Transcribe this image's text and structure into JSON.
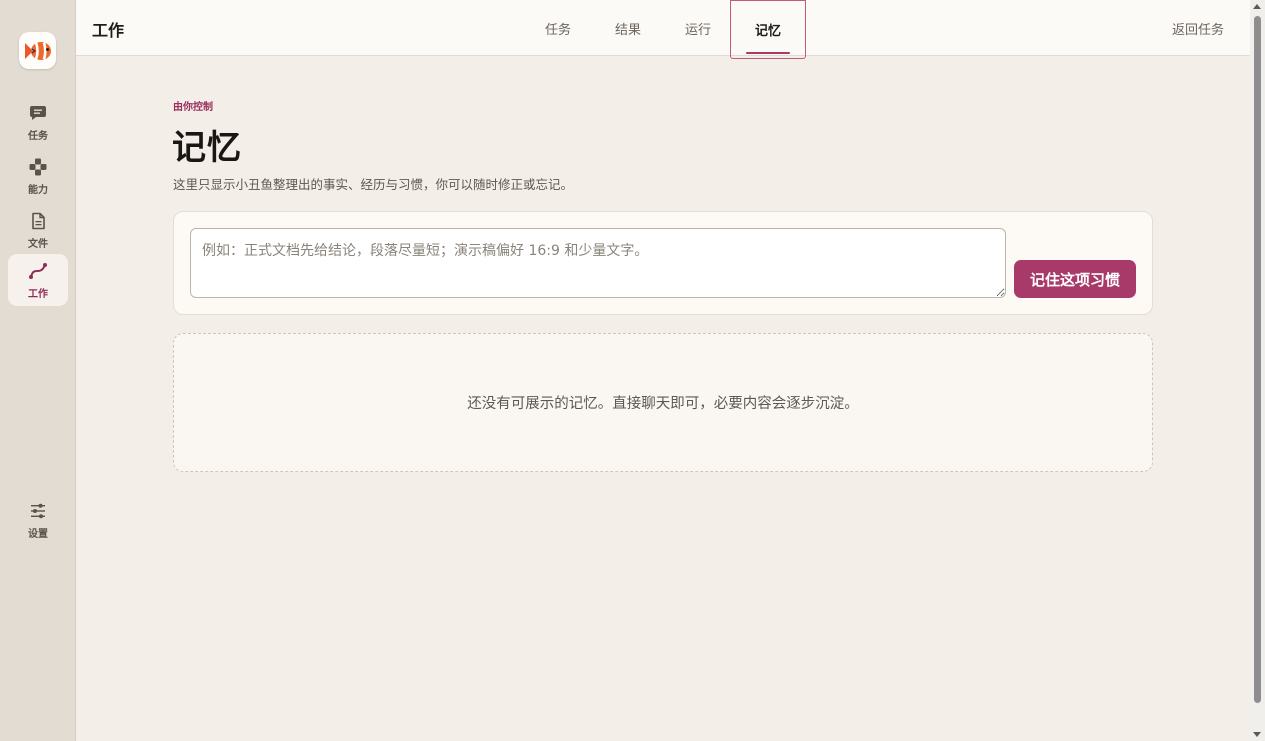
{
  "sidebar": {
    "items": [
      {
        "label": "任务",
        "icon": "chat-bubble-icon"
      },
      {
        "label": "能力",
        "icon": "gamepad-icon"
      },
      {
        "label": "文件",
        "icon": "document-icon"
      },
      {
        "label": "工作",
        "icon": "curve-path-icon",
        "active": true
      },
      {
        "label": "设置",
        "icon": "sliders-icon"
      }
    ]
  },
  "topbar": {
    "title": "工作",
    "tabs": [
      {
        "label": "任务"
      },
      {
        "label": "结果"
      },
      {
        "label": "运行"
      },
      {
        "label": "记忆",
        "active": true
      }
    ],
    "back_label": "返回任务"
  },
  "page": {
    "eyebrow": "由你控制",
    "title": "记忆",
    "subtitle": "这里只显示小丑鱼整理出的事实、经历与习惯，你可以随时修正或忘记。"
  },
  "memory_form": {
    "placeholder": "例如：正式文档先给结论，段落尽量短；演示稿偏好 16:9 和少量文字。",
    "value": "",
    "submit_label": "记住这项习惯"
  },
  "empty_state": {
    "text": "还没有可展示的记忆。直接聊天即可，必要内容会逐步沉淀。"
  },
  "colors": {
    "accent": "#a83a6a",
    "sidebar_bg": "#e3dcd2",
    "page_bg": "#f3eee8",
    "topbar_bg": "#fcfaf6"
  }
}
